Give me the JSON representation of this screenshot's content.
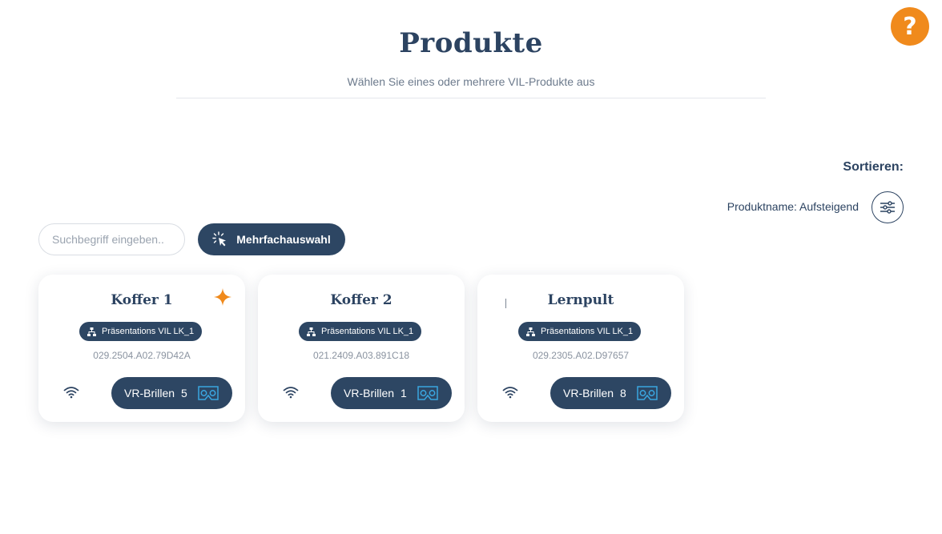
{
  "header": {
    "title": "Produkte",
    "subtitle": "Wählen Sie eines oder mehrere VIL-Produkte aus"
  },
  "help": {
    "label": "?"
  },
  "sort": {
    "label": "Sortieren:",
    "value": "Produktname: Aufsteigend",
    "icon": "sliders-icon"
  },
  "search": {
    "placeholder": "Suchbegriff eingeben..",
    "value": ""
  },
  "multi_select": {
    "label": "Mehrfachauswahl",
    "icon": "cursor-click-icon"
  },
  "colors": {
    "primary": "#2d4663",
    "accent": "#f08a1c",
    "vr_icon": "#3aa6e0"
  },
  "products": [
    {
      "name": "Koffer 1",
      "group": "Präsentations VIL LK_1",
      "serial": "029.2504.A02.79D42A",
      "vr_label": "VR-Brillen",
      "vr_count": "5",
      "favorite": true
    },
    {
      "name": "Koffer 2",
      "group": "Präsentations VIL LK_1",
      "serial": "021.2409.A03.891C18",
      "vr_label": "VR-Brillen",
      "vr_count": "1",
      "favorite": false
    },
    {
      "name": "Lernpult",
      "group": "Präsentations VIL LK_1",
      "serial": "029.2305.A02.D97657",
      "vr_label": "VR-Brillen",
      "vr_count": "8",
      "favorite": false
    }
  ]
}
